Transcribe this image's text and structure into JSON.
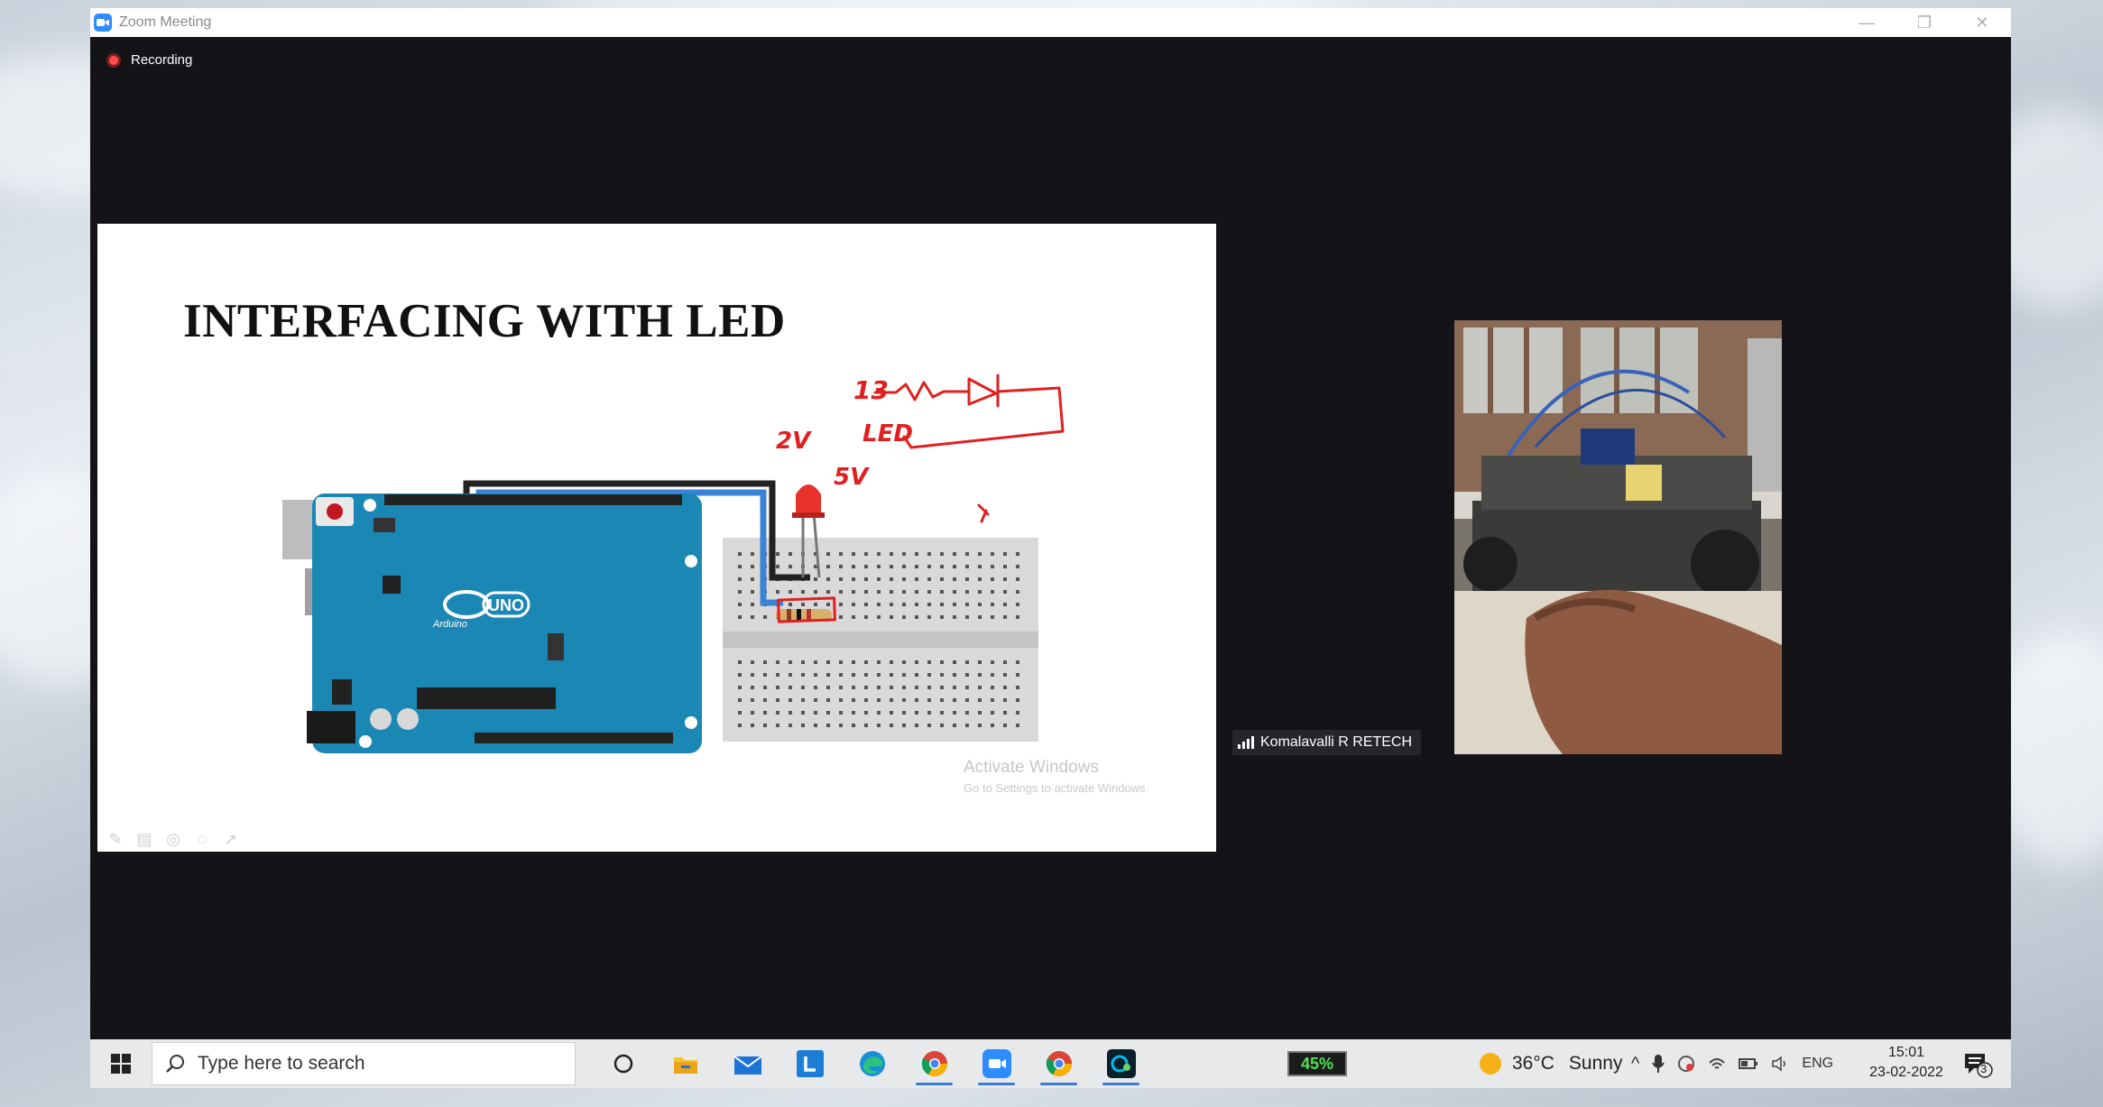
{
  "window": {
    "title": "Zoom Meeting",
    "minimize": "—",
    "restore": "❐",
    "close": "✕"
  },
  "recording": {
    "label": "Recording",
    "color": "#ff4d4d"
  },
  "slide": {
    "title": "INTERFACING WITH LED",
    "board_label": "UNO",
    "board_brand": "Arduino",
    "handwriting": {
      "pin": "13",
      "led": "LED",
      "voltage_led": "2V",
      "voltage_supply": "5V"
    },
    "watermark": {
      "line1": "Activate Windows",
      "line2": "Go to Settings to activate Windows."
    }
  },
  "participant": {
    "name": "Komalavalli R RETECH"
  },
  "taskbar": {
    "search_placeholder": "Type here to search",
    "apps": [
      "cortana-icon",
      "file-explorer-icon",
      "mail-icon",
      "l-app-icon",
      "edge-icon",
      "chrome-icon",
      "zoom-icon",
      "chrome-icon",
      "webex-icon"
    ],
    "battery": "45%",
    "weather": {
      "temp": "36°C",
      "condition": "Sunny"
    },
    "language": "ENG",
    "time": "15:01",
    "date": "23-02-2022",
    "notifications": "3"
  },
  "colors": {
    "zoom_bg": "#131318",
    "accent": "#2d8cff",
    "annotation": "#e02020",
    "arduino": "#1b87b4"
  }
}
